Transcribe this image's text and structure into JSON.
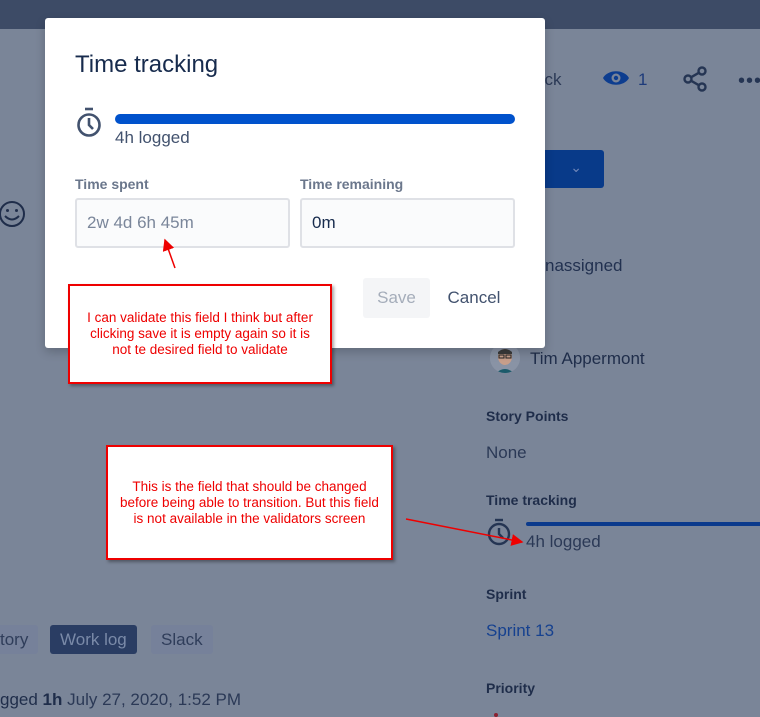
{
  "background": {
    "header": {
      "feedback_partial": "ack",
      "watchers_count": "1",
      "share_icon": "share-icon",
      "more_icon": "more-icon",
      "more_label": "•••"
    },
    "status_button": {
      "chevron": "⌄"
    },
    "assignee": {
      "value": "nassigned"
    },
    "reporter": {
      "name": "Tim Appermont"
    },
    "story_points": {
      "label": "Story Points",
      "value": "None"
    },
    "time_tracking": {
      "label": "Time tracking",
      "value": "4h logged",
      "progress_percent": 100
    },
    "sprint": {
      "label": "Sprint",
      "value": "Sprint 13"
    },
    "priority": {
      "label": "Priority"
    },
    "activity_tabs": [
      {
        "label": "tory",
        "active": false
      },
      {
        "label": "Work log",
        "active": true
      },
      {
        "label": "Slack",
        "active": false
      }
    ],
    "worklog_entry": {
      "prefix": "gged ",
      "amount": "1h",
      "date": " July 27, 2020, 1:52 PM"
    }
  },
  "modal": {
    "title": "Time tracking",
    "logged_text": "4h logged",
    "progress_percent": 100,
    "time_spent": {
      "label": "Time spent",
      "value": "",
      "placeholder": "2w 4d 6h 45m"
    },
    "time_remaining": {
      "label": "Time remaining",
      "value": "0m"
    },
    "save_label": "Save",
    "cancel_label": "Cancel"
  },
  "annotations": [
    {
      "text": "I can validate this field I think but after clicking save it is empty again so it is not te desired field to validate"
    },
    {
      "text": "This is the field that should be changed before being able to transition. But this field is not available in the validators screen"
    }
  ],
  "colors": {
    "primary": "#0052cc",
    "overlay": "#7a8598",
    "annotation": "#ee0000"
  }
}
